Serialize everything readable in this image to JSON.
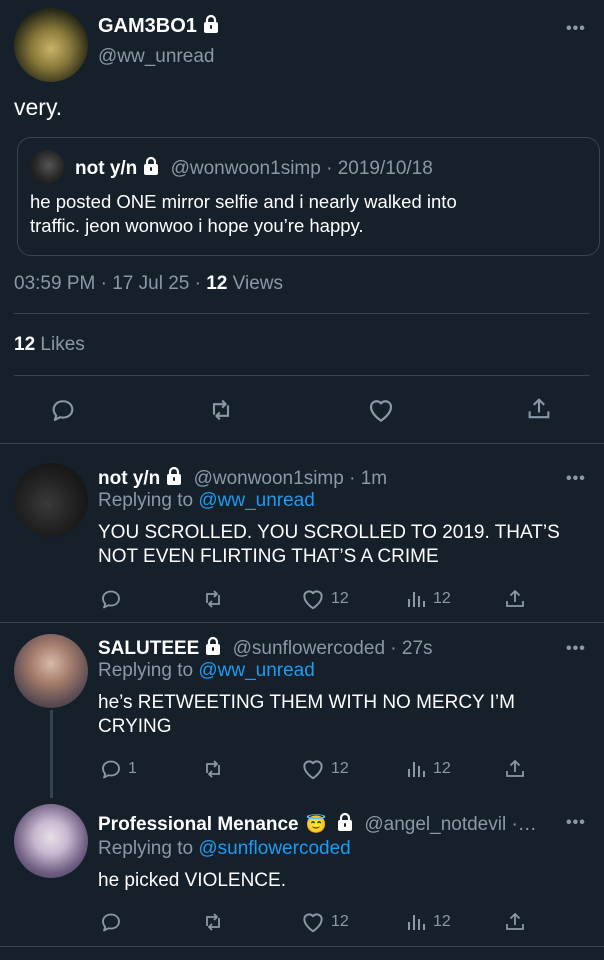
{
  "colors": {
    "background": "#15202b",
    "muted": "#8b98a5",
    "link": "#1d9bf0",
    "divider": "#38444d"
  },
  "main_tweet": {
    "display_name": "GAM3BO1",
    "handle": "@ww_unread",
    "text": "very.",
    "quoted": {
      "display_name": "not y/n",
      "handle": "@wonwoon1simp",
      "date": "· 2019/10/18",
      "text_line1": "he posted ONE mirror selfie and i nearly walked into",
      "text_line2": "traffic. jeon wonwoo i hope you’re happy."
    },
    "timestamp": "03:59 PM · 17 Jul 25 · ",
    "views_count": "12",
    "views_label": " Views",
    "likes_count": "12",
    "likes_label": " Likes"
  },
  "replies": [
    {
      "display_name": "not y/n",
      "handle": "@wonwoon1simp",
      "time": "· 1m",
      "replying_prefix": "Replying to ",
      "replying_to": "@ww_unread",
      "text_line1": "YOU SCROLLED. YOU SCROLLED TO 2019. THAT’S",
      "text_line2": "NOT EVEN FLIRTING THAT’S A CRIME",
      "reply_count": "",
      "like_count": "12",
      "view_count": "12"
    },
    {
      "display_name": "SALUTEEE",
      "handle": "@sunflowercoded",
      "time": "· 27s",
      "replying_prefix": "Replying to ",
      "replying_to": "@ww_unread",
      "text_line1": "he’s RETWEETING THEM WITH NO MERCY I’M",
      "text_line2": "CRYING",
      "reply_count": "1",
      "like_count": "12",
      "view_count": "12"
    },
    {
      "display_name": "Professional Menance",
      "emoji": "😇",
      "handle": "@angel_notdevil ·…",
      "replying_prefix": "Replying to ",
      "replying_to": "@sunflowercoded",
      "text_line1": "he picked VIOLENCE.",
      "reply_count": "",
      "like_count": "12",
      "view_count": "12"
    }
  ],
  "more_glyph": "•••"
}
